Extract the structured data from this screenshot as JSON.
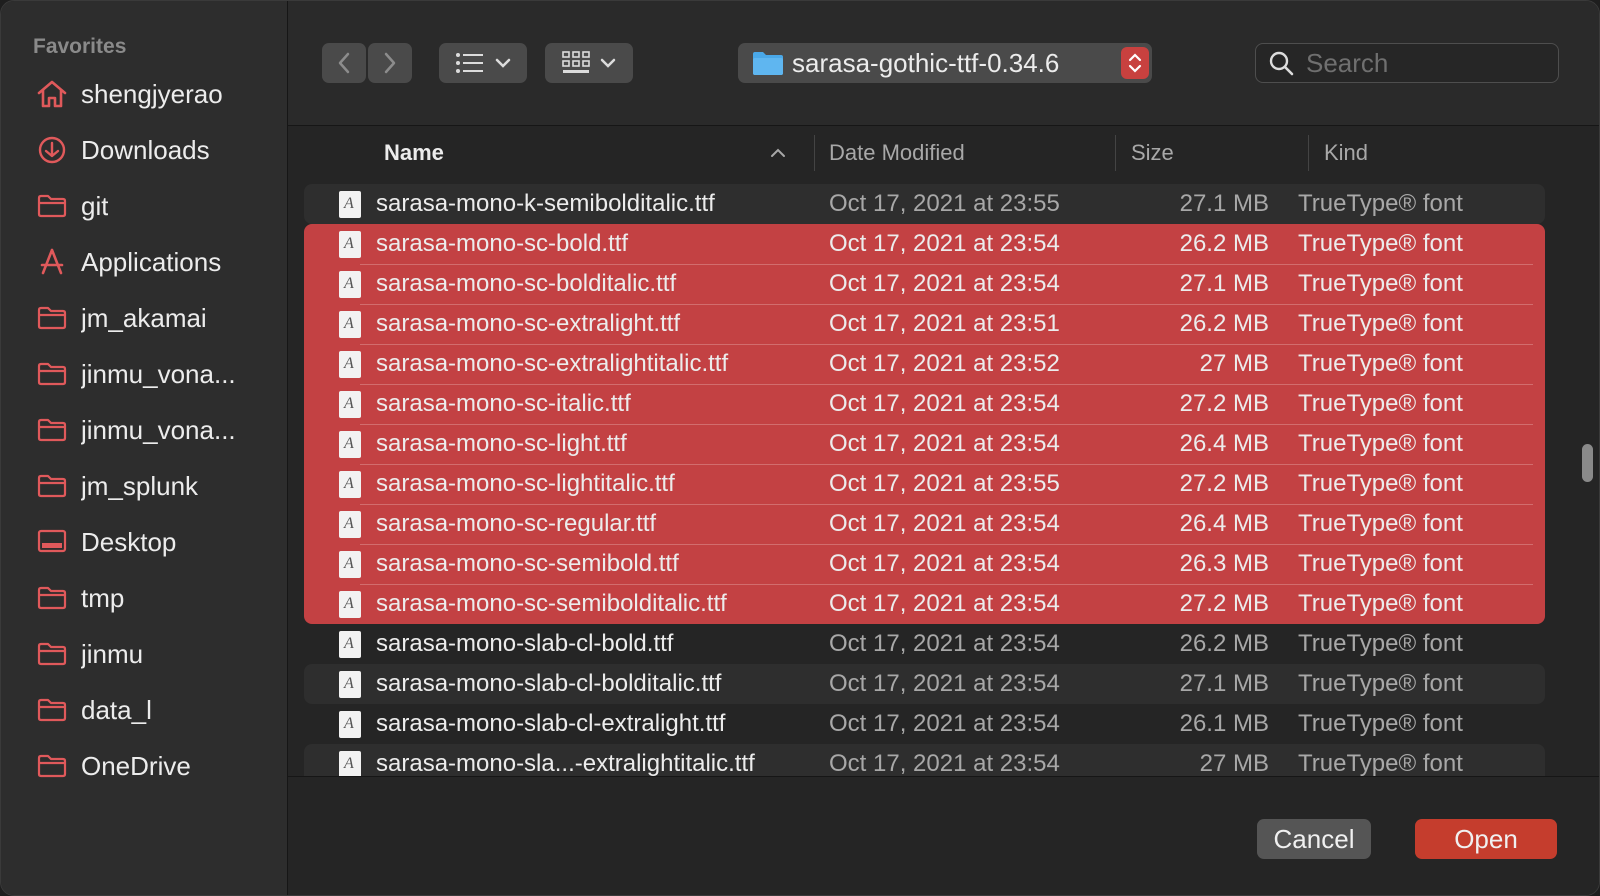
{
  "sidebar": {
    "heading": "Favorites",
    "items": [
      {
        "label": "shengjyerao",
        "icon": "home-icon"
      },
      {
        "label": "Downloads",
        "icon": "downloads-icon"
      },
      {
        "label": "git",
        "icon": "folder-icon"
      },
      {
        "label": "Applications",
        "icon": "applications-icon"
      },
      {
        "label": "jm_akamai",
        "icon": "folder-icon"
      },
      {
        "label": "jinmu_vona...",
        "icon": "folder-icon"
      },
      {
        "label": "jinmu_vona...",
        "icon": "folder-icon"
      },
      {
        "label": "jm_splunk",
        "icon": "folder-icon"
      },
      {
        "label": "Desktop",
        "icon": "desktop-icon"
      },
      {
        "label": "tmp",
        "icon": "folder-icon"
      },
      {
        "label": "jinmu",
        "icon": "folder-icon"
      },
      {
        "label": "data_l",
        "icon": "folder-icon"
      },
      {
        "label": "OneDrive",
        "icon": "folder-icon"
      }
    ]
  },
  "toolbar": {
    "path_label": "sarasa-gothic-ttf-0.34.6",
    "search_placeholder": "Search"
  },
  "columns": {
    "name": "Name",
    "date": "Date Modified",
    "size": "Size",
    "kind": "Kind"
  },
  "files": [
    {
      "name": "sarasa-mono-k-semibolditalic.ttf",
      "date": "Oct 17, 2021 at 23:55",
      "size": "27.1 MB",
      "kind": "TrueType® font",
      "selected": false
    },
    {
      "name": "sarasa-mono-sc-bold.ttf",
      "date": "Oct 17, 2021 at 23:54",
      "size": "26.2 MB",
      "kind": "TrueType® font",
      "selected": true
    },
    {
      "name": "sarasa-mono-sc-bolditalic.ttf",
      "date": "Oct 17, 2021 at 23:54",
      "size": "27.1 MB",
      "kind": "TrueType® font",
      "selected": true
    },
    {
      "name": "sarasa-mono-sc-extralight.ttf",
      "date": "Oct 17, 2021 at 23:51",
      "size": "26.2 MB",
      "kind": "TrueType® font",
      "selected": true
    },
    {
      "name": "sarasa-mono-sc-extralightitalic.ttf",
      "date": "Oct 17, 2021 at 23:52",
      "size": "27 MB",
      "kind": "TrueType® font",
      "selected": true
    },
    {
      "name": "sarasa-mono-sc-italic.ttf",
      "date": "Oct 17, 2021 at 23:54",
      "size": "27.2 MB",
      "kind": "TrueType® font",
      "selected": true
    },
    {
      "name": "sarasa-mono-sc-light.ttf",
      "date": "Oct 17, 2021 at 23:54",
      "size": "26.4 MB",
      "kind": "TrueType® font",
      "selected": true
    },
    {
      "name": "sarasa-mono-sc-lightitalic.ttf",
      "date": "Oct 17, 2021 at 23:55",
      "size": "27.2 MB",
      "kind": "TrueType® font",
      "selected": true
    },
    {
      "name": "sarasa-mono-sc-regular.ttf",
      "date": "Oct 17, 2021 at 23:54",
      "size": "26.4 MB",
      "kind": "TrueType® font",
      "selected": true
    },
    {
      "name": "sarasa-mono-sc-semibold.ttf",
      "date": "Oct 17, 2021 at 23:54",
      "size": "26.3 MB",
      "kind": "TrueType® font",
      "selected": true
    },
    {
      "name": "sarasa-mono-sc-semibolditalic.ttf",
      "date": "Oct 17, 2021 at 23:54",
      "size": "27.2 MB",
      "kind": "TrueType® font",
      "selected": true
    },
    {
      "name": "sarasa-mono-slab-cl-bold.ttf",
      "date": "Oct 17, 2021 at 23:54",
      "size": "26.2 MB",
      "kind": "TrueType® font",
      "selected": false
    },
    {
      "name": "sarasa-mono-slab-cl-bolditalic.ttf",
      "date": "Oct 17, 2021 at 23:54",
      "size": "27.1 MB",
      "kind": "TrueType® font",
      "selected": false
    },
    {
      "name": "sarasa-mono-slab-cl-extralight.ttf",
      "date": "Oct 17, 2021 at 23:54",
      "size": "26.1 MB",
      "kind": "TrueType® font",
      "selected": false
    },
    {
      "name": "sarasa-mono-sla...-extralightitalic.ttf",
      "date": "Oct 17, 2021 at 23:54",
      "size": "27 MB",
      "kind": "TrueType® font",
      "selected": false
    }
  ],
  "footer": {
    "cancel_label": "Cancel",
    "open_label": "Open"
  },
  "colors": {
    "accent": "#c34143",
    "folder_icon": "#e0595b",
    "path_folder": "#4aa8e8"
  }
}
